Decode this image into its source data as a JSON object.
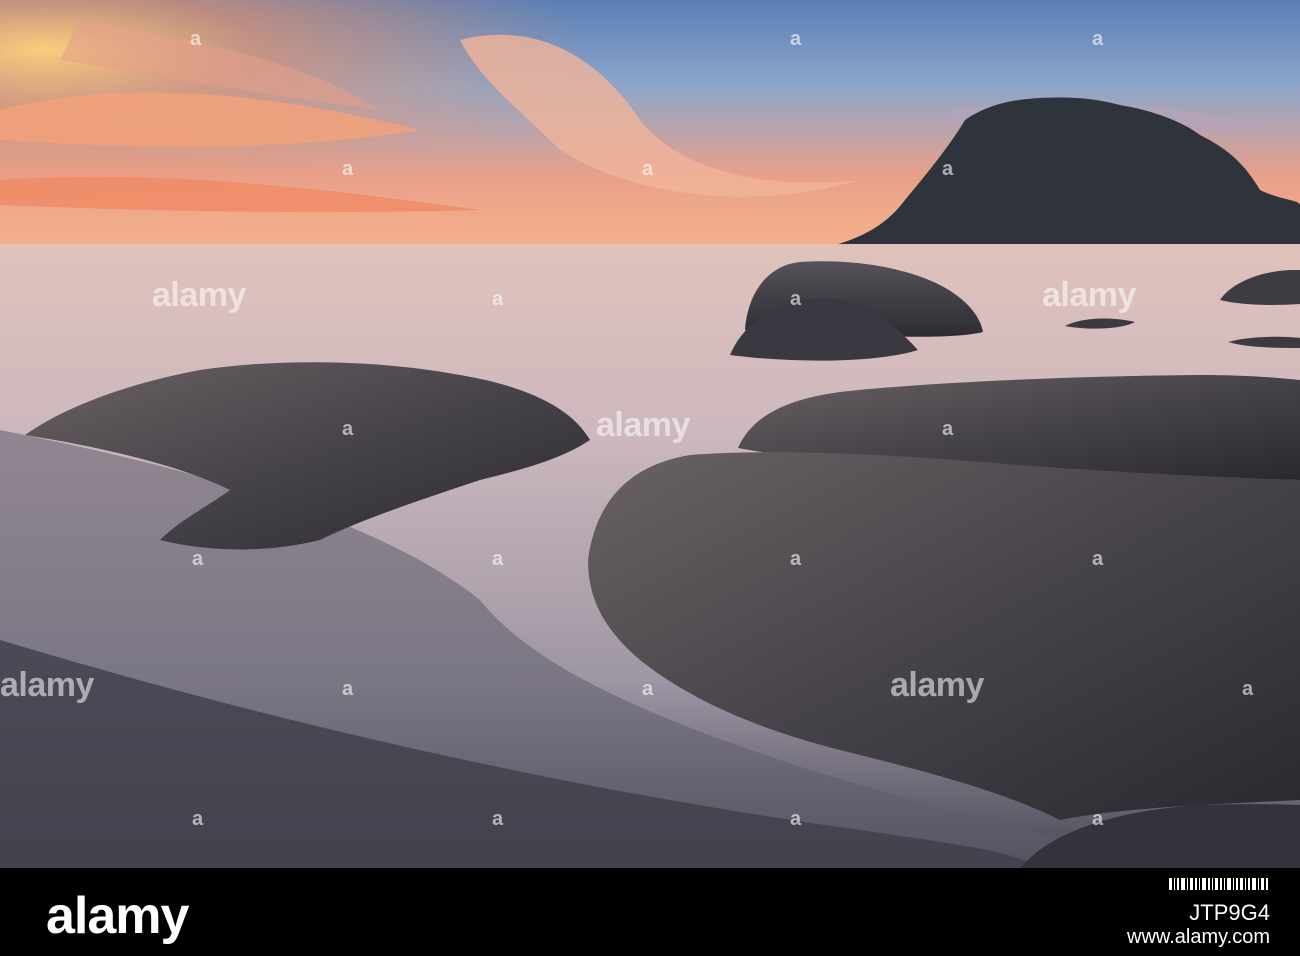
{
  "photo": {
    "watermark_text": "alamy",
    "watermark_mark": "a"
  },
  "footer": {
    "brand": "alamy",
    "image_id": "JTP9G4",
    "site": "www.alamy.com"
  },
  "colors": {
    "sky_top": "#4a78b4",
    "sunset": "#f6a070",
    "sea": "#cdb8bc",
    "rock": "#3b3a40",
    "mountain": "#2c3038"
  }
}
